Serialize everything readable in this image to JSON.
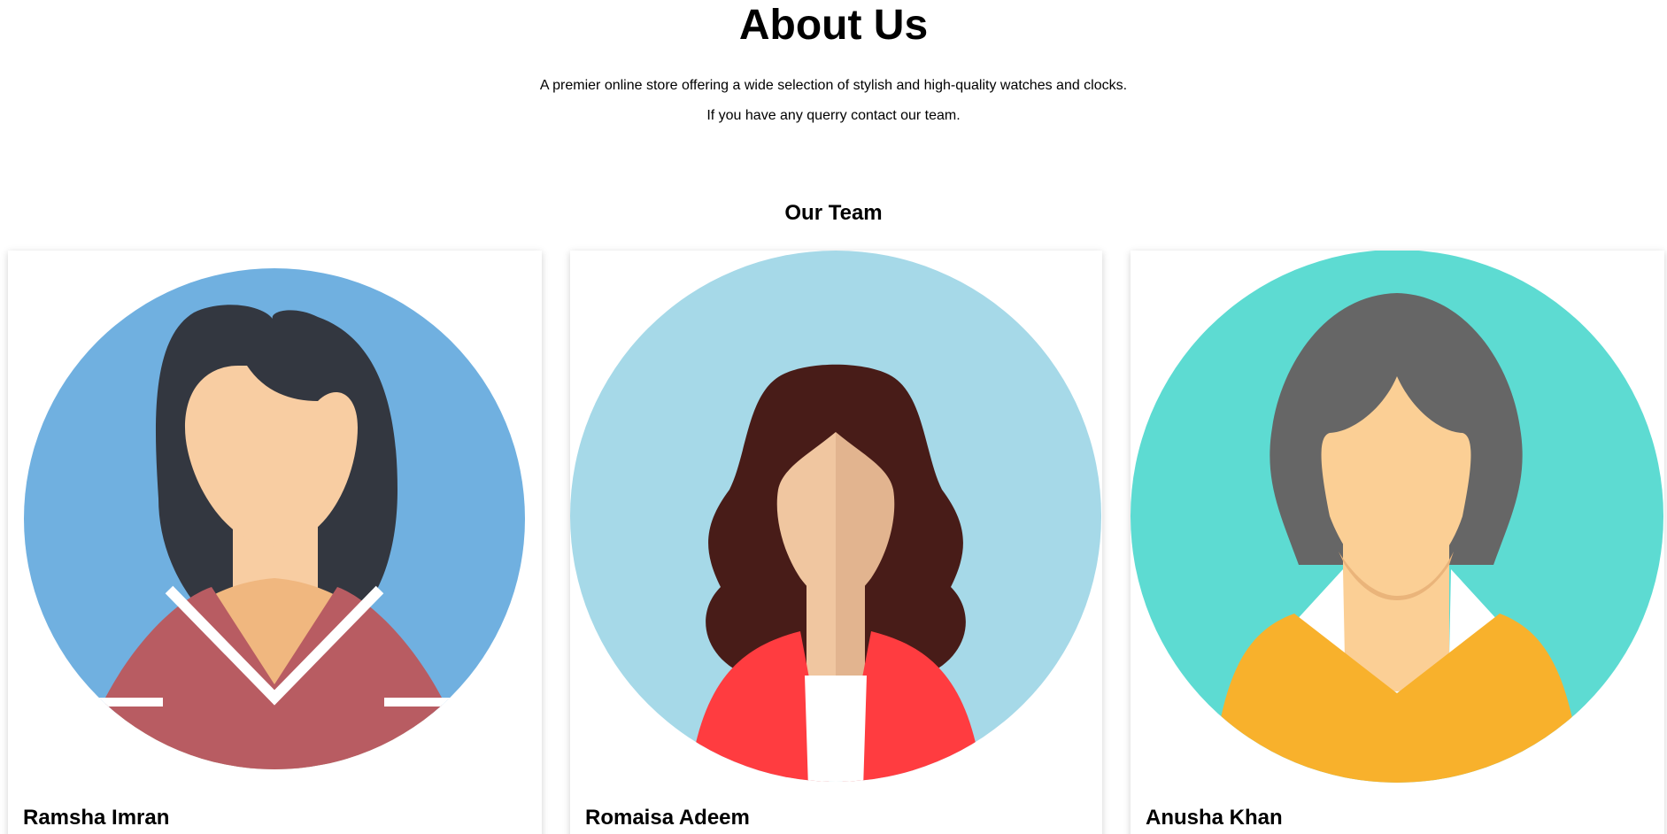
{
  "header": {
    "title": "About Us",
    "description_line1": "A premier online store offering a wide selection of stylish and high-quality watches and clocks.",
    "description_line2": "If you have any querry contact our team."
  },
  "team": {
    "heading": "Our Team",
    "members": [
      {
        "name": "Ramsha Imran",
        "avatar_icon": "woman-avatar-icon",
        "colors": {
          "background": "#70b0e0",
          "hair": "#333740",
          "skin": "#f8cda2",
          "shirt": "#b85c62"
        }
      },
      {
        "name": "Romaisa Adeem",
        "avatar_icon": "woman-avatar-icon",
        "colors": {
          "background": "#a6d9e8",
          "hair": "#481c18",
          "skin": "#f0c6a0",
          "jacket": "#ff3c40"
        }
      },
      {
        "name": "Anusha Khan",
        "avatar_icon": "woman-avatar-icon",
        "colors": {
          "background": "#5ddbd2",
          "hair": "#666666",
          "skin": "#fbcf95",
          "shirt": "#f8b12c"
        }
      }
    ]
  }
}
